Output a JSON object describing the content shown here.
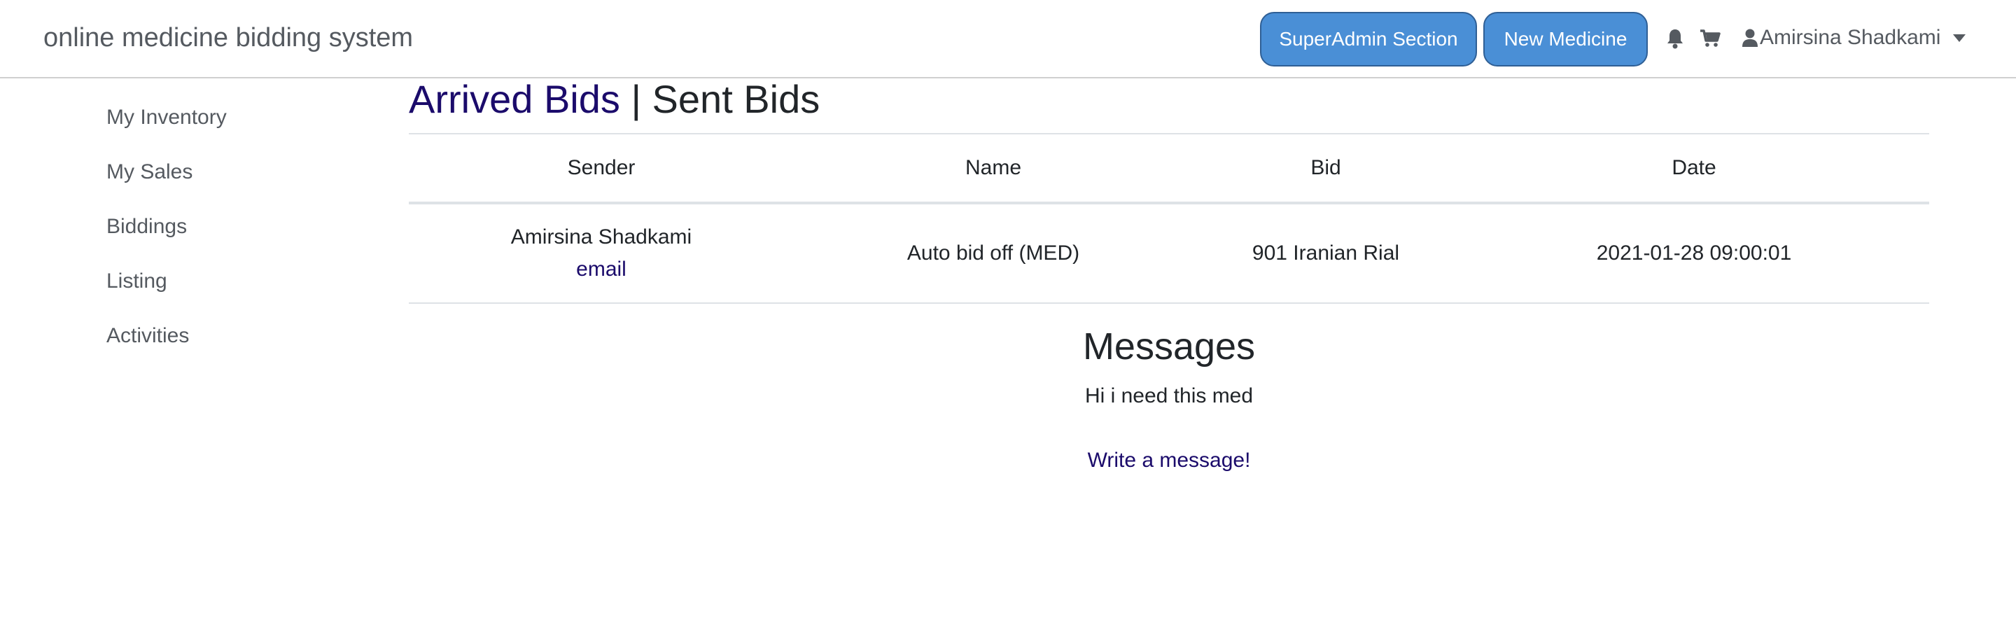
{
  "navbar": {
    "brand": "online medicine bidding system",
    "superadmin_button": "SuperAdmin Section",
    "new_medicine_button": "New Medicine",
    "bell_icon": "bell-icon",
    "cart_icon": "cart-icon",
    "user_name": "Amirsina Shadkami"
  },
  "sidebar": {
    "items": [
      {
        "label": "My Inventory"
      },
      {
        "label": "My Sales"
      },
      {
        "label": "Biddings"
      },
      {
        "label": "Listing"
      },
      {
        "label": "Activities"
      }
    ]
  },
  "main": {
    "arrived_bids": "Arrived Bids",
    "separator": "|",
    "sent_bids": "Sent Bids",
    "table": {
      "headers": [
        "Sender",
        "Name",
        "Bid",
        "Date"
      ],
      "rows": [
        {
          "sender": "Amirsina Shadkami",
          "sender_link": "email",
          "name": "Auto bid off (MED)",
          "bid": "901 Iranian Rial",
          "date": "2021-01-28 09:00:01"
        }
      ]
    },
    "messages": {
      "title": "Messages",
      "items": [
        "Hi i need this med"
      ],
      "write_link": "Write a message!"
    }
  },
  "colors": {
    "button_bg": "#4a8fd6",
    "link": "#1b0b6b",
    "text": "#212529",
    "muted": "#555a60"
  }
}
